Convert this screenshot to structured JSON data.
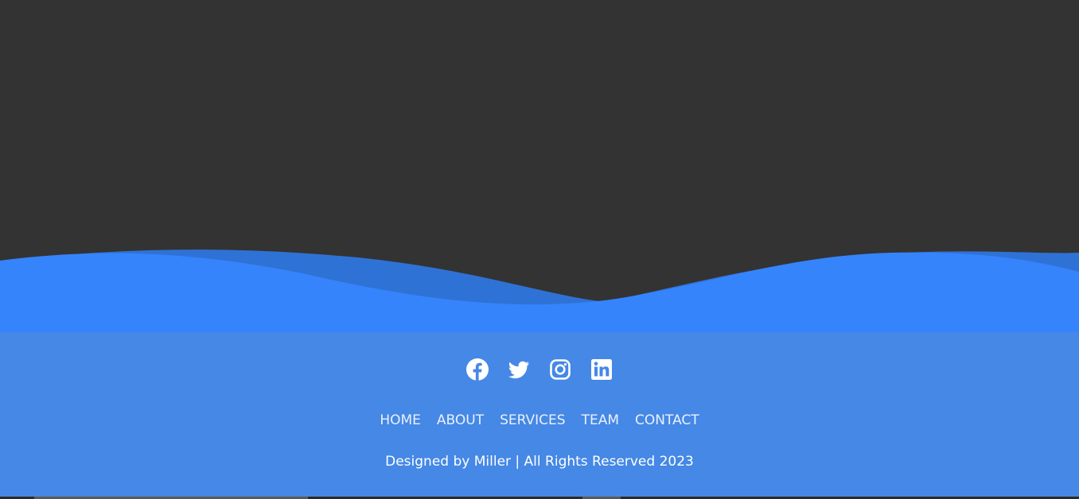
{
  "colors": {
    "background": "#333333",
    "footer": "#4588e6",
    "wave_front": "#3584fc",
    "wave_back": "#2f72d6"
  },
  "social": [
    {
      "icon": "facebook-icon"
    },
    {
      "icon": "twitter-icon"
    },
    {
      "icon": "instagram-icon"
    },
    {
      "icon": "linkedin-icon"
    }
  ],
  "menu": {
    "items": [
      "HOME",
      "ABOUT",
      "SERVICES",
      "TEAM",
      "CONTACT"
    ]
  },
  "footer": {
    "credit": "Designed by Miller | All Rights Reserved 2023"
  }
}
